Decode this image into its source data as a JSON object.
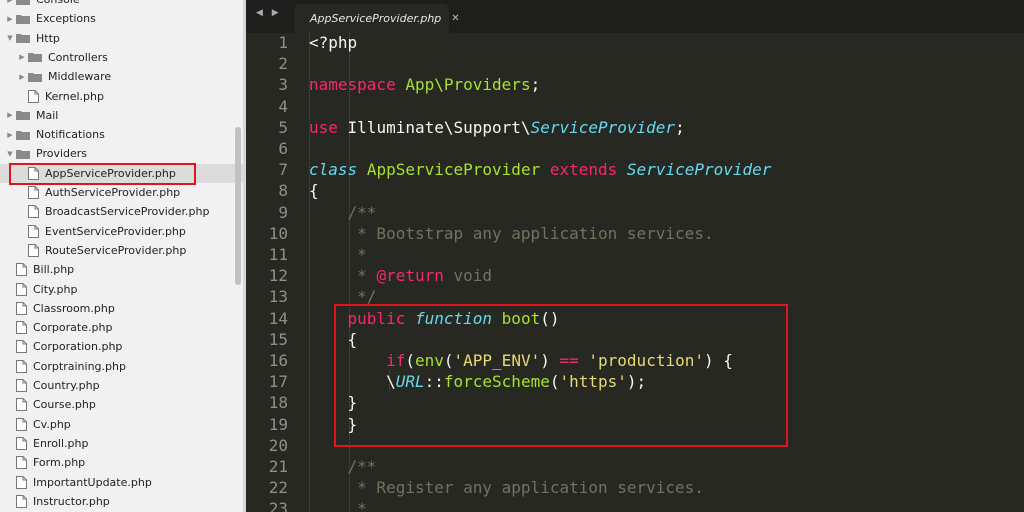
{
  "sidebar": {
    "rows": [
      {
        "label": "Console",
        "type": "folder",
        "indent": 1,
        "expanded": false
      },
      {
        "label": "Exceptions",
        "type": "folder",
        "indent": 1,
        "expanded": false
      },
      {
        "label": "Http",
        "type": "folder",
        "indent": 1,
        "expanded": true
      },
      {
        "label": "Controllers",
        "type": "folder",
        "indent": 2,
        "expanded": false
      },
      {
        "label": "Middleware",
        "type": "folder",
        "indent": 2,
        "expanded": false
      },
      {
        "label": "Kernel.php",
        "type": "file",
        "indent": 2
      },
      {
        "label": "Mail",
        "type": "folder",
        "indent": 1,
        "expanded": false
      },
      {
        "label": "Notifications",
        "type": "folder",
        "indent": 1,
        "expanded": false
      },
      {
        "label": "Providers",
        "type": "folder",
        "indent": 1,
        "expanded": true
      },
      {
        "label": "AppServiceProvider.php",
        "type": "file",
        "indent": 2,
        "selected": true
      },
      {
        "label": "AuthServiceProvider.php",
        "type": "file",
        "indent": 2
      },
      {
        "label": "BroadcastServiceProvider.php",
        "type": "file",
        "indent": 2
      },
      {
        "label": "EventServiceProvider.php",
        "type": "file",
        "indent": 2
      },
      {
        "label": "RouteServiceProvider.php",
        "type": "file",
        "indent": 2
      },
      {
        "label": "Bill.php",
        "type": "file",
        "indent": 1
      },
      {
        "label": "City.php",
        "type": "file",
        "indent": 1
      },
      {
        "label": "Classroom.php",
        "type": "file",
        "indent": 1
      },
      {
        "label": "Corporate.php",
        "type": "file",
        "indent": 1
      },
      {
        "label": "Corporation.php",
        "type": "file",
        "indent": 1
      },
      {
        "label": "Corptraining.php",
        "type": "file",
        "indent": 1
      },
      {
        "label": "Country.php",
        "type": "file",
        "indent": 1
      },
      {
        "label": "Course.php",
        "type": "file",
        "indent": 1
      },
      {
        "label": "Cv.php",
        "type": "file",
        "indent": 1
      },
      {
        "label": "Enroll.php",
        "type": "file",
        "indent": 1
      },
      {
        "label": "Form.php",
        "type": "file",
        "indent": 1
      },
      {
        "label": "ImportantUpdate.php",
        "type": "file",
        "indent": 1
      },
      {
        "label": "Instructor.php",
        "type": "file",
        "indent": 1
      }
    ]
  },
  "tabs": {
    "nav": "◀ ▶",
    "active_label": "AppServiceProvider.php",
    "close": "✕"
  },
  "editor": {
    "lines": [
      {
        "n": "1",
        "tokens": [
          {
            "t": "<?php"
          }
        ]
      },
      {
        "n": "2",
        "tokens": []
      },
      {
        "n": "3",
        "tokens": [
          {
            "t": "namespace",
            "c": "kw"
          },
          {
            "t": " "
          },
          {
            "t": "App\\Providers",
            "c": "fn"
          },
          {
            "t": ";"
          }
        ]
      },
      {
        "n": "4",
        "tokens": []
      },
      {
        "n": "5",
        "tokens": [
          {
            "t": "use",
            "c": "kw"
          },
          {
            "t": " Illuminate\\Support\\"
          },
          {
            "t": "ServiceProvider",
            "c": "st"
          },
          {
            "t": ";"
          }
        ]
      },
      {
        "n": "6",
        "tokens": []
      },
      {
        "n": "7",
        "tokens": [
          {
            "t": "class",
            "c": "st"
          },
          {
            "t": " "
          },
          {
            "t": "AppServiceProvider",
            "c": "fn"
          },
          {
            "t": " "
          },
          {
            "t": "extends",
            "c": "kw"
          },
          {
            "t": " "
          },
          {
            "t": "ServiceProvider",
            "c": "st"
          }
        ]
      },
      {
        "n": "8",
        "tokens": [
          {
            "t": "{"
          }
        ]
      },
      {
        "n": "9",
        "tokens": [
          {
            "t": "    "
          },
          {
            "t": "/**",
            "c": "cm"
          }
        ]
      },
      {
        "n": "10",
        "tokens": [
          {
            "t": "     * Bootstrap any application services.",
            "c": "cm"
          }
        ]
      },
      {
        "n": "11",
        "tokens": [
          {
            "t": "     *",
            "c": "cm"
          }
        ]
      },
      {
        "n": "12",
        "tokens": [
          {
            "t": "     * ",
            "c": "cm"
          },
          {
            "t": "@return",
            "c": "kw"
          },
          {
            "t": " void",
            "c": "cm"
          }
        ]
      },
      {
        "n": "13",
        "tokens": [
          {
            "t": "     */",
            "c": "cm"
          }
        ]
      },
      {
        "n": "14",
        "tokens": [
          {
            "t": "    "
          },
          {
            "t": "public",
            "c": "kw"
          },
          {
            "t": " "
          },
          {
            "t": "function",
            "c": "st"
          },
          {
            "t": " "
          },
          {
            "t": "boot",
            "c": "fn"
          },
          {
            "t": "()"
          }
        ]
      },
      {
        "n": "15",
        "tokens": [
          {
            "t": "    {"
          }
        ]
      },
      {
        "n": "16",
        "tokens": [
          {
            "t": "        "
          },
          {
            "t": "if",
            "c": "kw"
          },
          {
            "t": "("
          },
          {
            "t": "env",
            "c": "fn"
          },
          {
            "t": "("
          },
          {
            "t": "'APP_ENV'",
            "c": "str"
          },
          {
            "t": ") "
          },
          {
            "t": "==",
            "c": "kw"
          },
          {
            "t": " "
          },
          {
            "t": "'production'",
            "c": "str"
          },
          {
            "t": ") {"
          }
        ]
      },
      {
        "n": "17",
        "tokens": [
          {
            "t": "        \\"
          },
          {
            "t": "URL",
            "c": "st"
          },
          {
            "t": "::"
          },
          {
            "t": "forceScheme",
            "c": "fn"
          },
          {
            "t": "("
          },
          {
            "t": "'https'",
            "c": "str"
          },
          {
            "t": ");"
          }
        ]
      },
      {
        "n": "18",
        "tokens": [
          {
            "t": "    }"
          }
        ]
      },
      {
        "n": "19",
        "tokens": [
          {
            "t": "    }"
          }
        ]
      },
      {
        "n": "20",
        "tokens": []
      },
      {
        "n": "21",
        "tokens": [
          {
            "t": "    "
          },
          {
            "t": "/**",
            "c": "cm"
          }
        ]
      },
      {
        "n": "22",
        "tokens": [
          {
            "t": "     * Register any application services.",
            "c": "cm"
          }
        ]
      },
      {
        "n": "23",
        "tokens": [
          {
            "t": "     *",
            "c": "cm"
          }
        ]
      }
    ]
  },
  "colors": {
    "highlight": "#e0141e",
    "editor_bg": "#272822",
    "keyword": "#f92672",
    "storage": "#66d9ef",
    "function": "#a6e22e",
    "string": "#e6db74",
    "comment": "#75715e"
  }
}
